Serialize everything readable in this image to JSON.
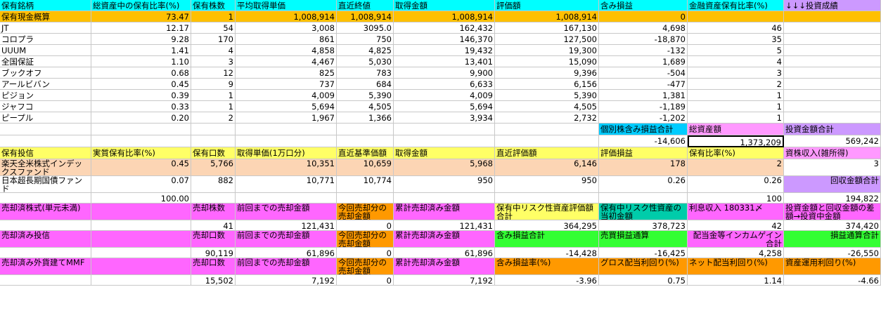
{
  "colors": {
    "header": "#00ffff",
    "cash": "#ffc000",
    "green": "#00ff99",
    "yellow": "#ffff66",
    "peach": "#fcd5b4",
    "pink": "#ff66ff",
    "orange": "#ff9900",
    "teal": "#00ccaa",
    "lime": "#33ff33",
    "magenta": "#ff99ff",
    "lavender": "#cc99ff",
    "sky": "#00ccff"
  },
  "rows": [
    [
      "保有銘柄",
      "総資産中の保有比率(%)",
      "保有株数",
      "平均取得単価",
      "直近終値",
      "取得金額",
      "評価額",
      "含み損益",
      "金融資産保有比率(%)",
      "↓↓↓投資成績"
    ],
    [
      "保有現金概算",
      "73.47",
      "1",
      "1,008,914",
      "1,008,914",
      "1,008,914",
      "1,008,914",
      "0",
      "",
      ""
    ],
    [
      "JT",
      "12.17",
      "54",
      "3,008",
      "3095.0",
      "162,432",
      "167,130",
      "4,698",
      "46",
      ""
    ],
    [
      "コロプラ",
      "9.28",
      "170",
      "861",
      "750",
      "146,370",
      "127,500",
      "-18,870",
      "35",
      ""
    ],
    [
      "UUUM",
      "1.41",
      "4",
      "4,858",
      "4,825",
      "19,432",
      "19,300",
      "-132",
      "5",
      ""
    ],
    [
      "全国保証",
      "1.10",
      "3",
      "4,467",
      "5,030",
      "13,401",
      "15,090",
      "1,689",
      "4",
      ""
    ],
    [
      "ブックオフ",
      "0.68",
      "12",
      "825",
      "783",
      "9,900",
      "9,396",
      "-504",
      "3",
      ""
    ],
    [
      "アールビバン",
      "0.45",
      "9",
      "737",
      "684",
      "6,633",
      "6,156",
      "-477",
      "2",
      ""
    ],
    [
      "ピジョン",
      "0.39",
      "1",
      "4,009",
      "5,390",
      "4,009",
      "5,390",
      "1,381",
      "1",
      ""
    ],
    [
      "ジャフコ",
      "0.33",
      "1",
      "5,694",
      "4,505",
      "5,694",
      "4,505",
      "-1,189",
      "1",
      ""
    ],
    [
      "ピープル",
      "0.20",
      "2",
      "1,967",
      "1,366",
      "3,934",
      "2,732",
      "-1,202",
      "1",
      ""
    ],
    [
      "",
      "",
      "",
      "",
      "",
      "",
      "",
      "個別株含み損益合計",
      "総資産額",
      "投資金額合計"
    ],
    [
      "",
      "",
      "",
      "",
      "",
      "",
      "",
      "-14,606",
      "1,373,209",
      "569,242"
    ],
    [
      "保有投信",
      "実質保有比率(%)",
      "保有口数",
      "取得単価(1万口分)",
      "直近基準価額",
      "取得金額",
      "直近評価額",
      "評価損益",
      "保有比率(%)",
      "資株収入(雑所得)"
    ],
    [
      "楽天全米株式インデックスファンド",
      "0.45",
      "5,766",
      "10,351",
      "10,659",
      "5,968",
      "6,146",
      "178",
      "2",
      "3"
    ],
    [
      "日本超長期国債ファンド",
      "0.07",
      "882",
      "10,771",
      "10,774",
      "950",
      "950",
      "0.26",
      "0.26",
      "回収金額合計"
    ],
    [
      "",
      "100.00",
      "",
      "",
      "",
      "",
      "",
      "",
      "100",
      "194,822"
    ],
    [
      "売却済株式(単元未満)",
      "",
      "売却株数",
      "前回までの売却金額",
      "今回売却分の売却金額",
      "累計売却済み金額",
      "保有中リスク性資産評価額合計",
      "保有中リスク性資産の当初金額",
      "利息収入 180331〆",
      "投資金額と回収金額の差額→投資中金額"
    ],
    [
      "",
      "",
      "41",
      "121,431",
      "0",
      "121,431",
      "364,295",
      "378,723",
      "42",
      "374,420"
    ],
    [
      "売却済み投信",
      "",
      "売却口数",
      "前回までの売却金額",
      "今回売却分の売却金額",
      "累計売却済み金額",
      "含み損益合計",
      "売買損益通算",
      "配当金等インカムゲイン合計",
      "損益通算合計"
    ],
    [
      "",
      "",
      "90,119",
      "61,896",
      "0",
      "61,896",
      "-14,428",
      "-16,425",
      "4,258",
      "-26,550"
    ],
    [
      "売却済み外貨建てMMF",
      "",
      "売却口数",
      "前回までの売却金額",
      "今回売却分の売却金額",
      "累計売却済み金額",
      "含み損益率(%)",
      "グロス配当利回り(%)",
      "ネット配当利回り(%)",
      "資産運用利回り(%)"
    ],
    [
      "",
      "",
      "15,502",
      "7,192",
      "0",
      "7,192",
      "-3.96",
      "0.75",
      "1.14",
      "-4.66"
    ]
  ]
}
